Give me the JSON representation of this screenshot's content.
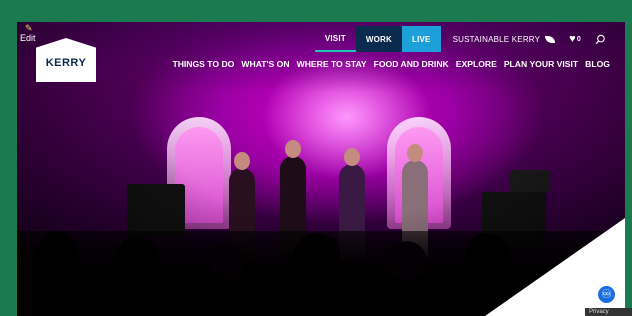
{
  "edit": {
    "label": "Edit",
    "icon": "pencil-icon"
  },
  "logo": {
    "text": "KERRY"
  },
  "top_nav": {
    "items": [
      "VISIT",
      "WORK",
      "LIVE"
    ],
    "sustainable_label": "SUSTAINABLE KERRY",
    "favourites_count": "0",
    "icons": [
      "leaf-icon",
      "heart-icon",
      "search-icon"
    ]
  },
  "main_nav": {
    "items": [
      "THINGS TO DO",
      "WHAT'S ON",
      "WHERE TO STAY",
      "FOOD AND DRINK",
      "EXPLORE",
      "PLAN YOUR VISIT",
      "BLOG"
    ]
  },
  "accessibility": {
    "icon": "accessibility-icon"
  },
  "privacy": {
    "label": "Privacy"
  },
  "colors": {
    "frame": "#1b7a4f",
    "work_bg": "#0a2a4e",
    "live_bg": "#1d9fd9",
    "visit_underline": "#21c5b4",
    "logo_text": "#0c2a4a"
  }
}
